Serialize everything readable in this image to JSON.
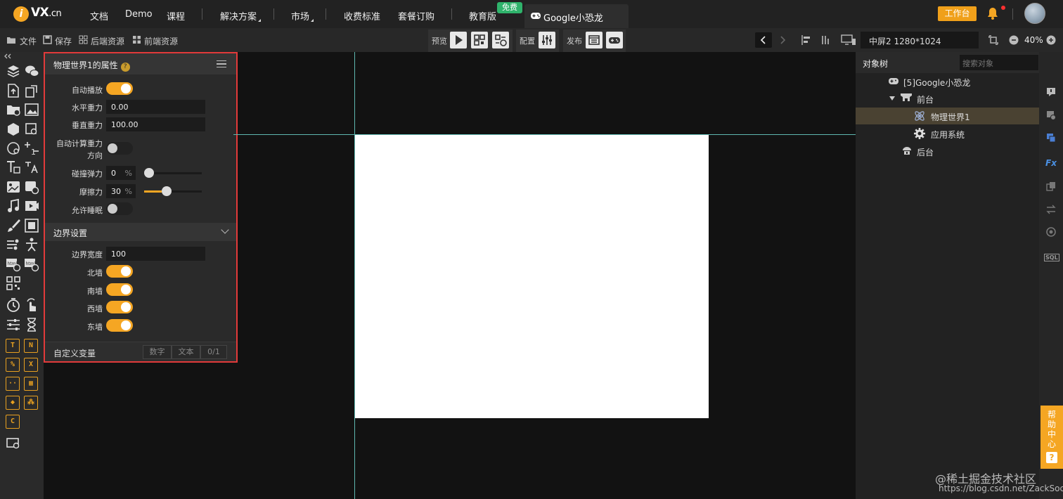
{
  "brand": {
    "logo_letter": "i",
    "name": "VX",
    "suffix": ".cn"
  },
  "nav": {
    "items": [
      "文档",
      "Demo",
      "课程",
      "解决方案",
      "市场",
      "收费标准",
      "套餐订购",
      "教育版"
    ],
    "free_badge": "免费",
    "project_tab": "Google小恐龙",
    "workspace_button": "工作台"
  },
  "toolbar": {
    "file": "文件",
    "save": "保存",
    "backend": "后端资源",
    "frontend": "前端资源",
    "preview": "预览",
    "config": "配置",
    "publish": "发布",
    "screen": "中屏2 1280*1024",
    "zoom": "40%"
  },
  "props": {
    "title": "物理世界1的属性",
    "help": "?",
    "fields": {
      "autoplay": {
        "label": "自动播放",
        "on": true
      },
      "gravity_x": {
        "label": "水平重力",
        "value": "0.00"
      },
      "gravity_y": {
        "label": "垂直重力",
        "value": "100.00"
      },
      "auto_gravity": {
        "label": "自动计算重力方向",
        "label_line1": "自动计算重力",
        "label_line2": "方向",
        "on": false
      },
      "restitution": {
        "label": "碰撞弹力",
        "value": "0",
        "unit": "%",
        "level": 0
      },
      "friction": {
        "label": "摩擦力",
        "value": "30",
        "unit": "%",
        "level": 0.3
      },
      "allow_sleep": {
        "label": "允许睡眠",
        "on": false
      }
    },
    "boundary": {
      "title": "边界设置",
      "width_label": "边界宽度",
      "width_value": "100",
      "walls": [
        {
          "label": "北墙",
          "on": true
        },
        {
          "label": "南墙",
          "on": true
        },
        {
          "label": "西墙",
          "on": true
        },
        {
          "label": "东墙",
          "on": true
        }
      ]
    },
    "custom_vars": {
      "label": "自定义变量",
      "buttons": [
        "数字",
        "文本",
        "0/1"
      ]
    }
  },
  "tree": {
    "tab": "对象树",
    "search_placeholder": "搜索对象",
    "nodes": [
      {
        "label": "[5]Google小恐龙",
        "icon": "gamepad-icon"
      },
      {
        "label": "前台",
        "icon": "stage-icon",
        "expanded": true
      },
      {
        "label": "物理世界1",
        "icon": "physics-icon",
        "selected": true
      },
      {
        "label": "应用系统",
        "icon": "gear-icon"
      },
      {
        "label": "后台",
        "icon": "backend-icon"
      }
    ]
  },
  "help_center": {
    "label": "帮助中心",
    "q": "?"
  },
  "watermark": {
    "line1": "@稀土掘金技术社区",
    "line2": "https://blog.csdn.net/ZackSock"
  },
  "colors": {
    "accent": "#f5a623",
    "badge_green": "#2fb36b",
    "highlight_border": "#e23a3a"
  }
}
